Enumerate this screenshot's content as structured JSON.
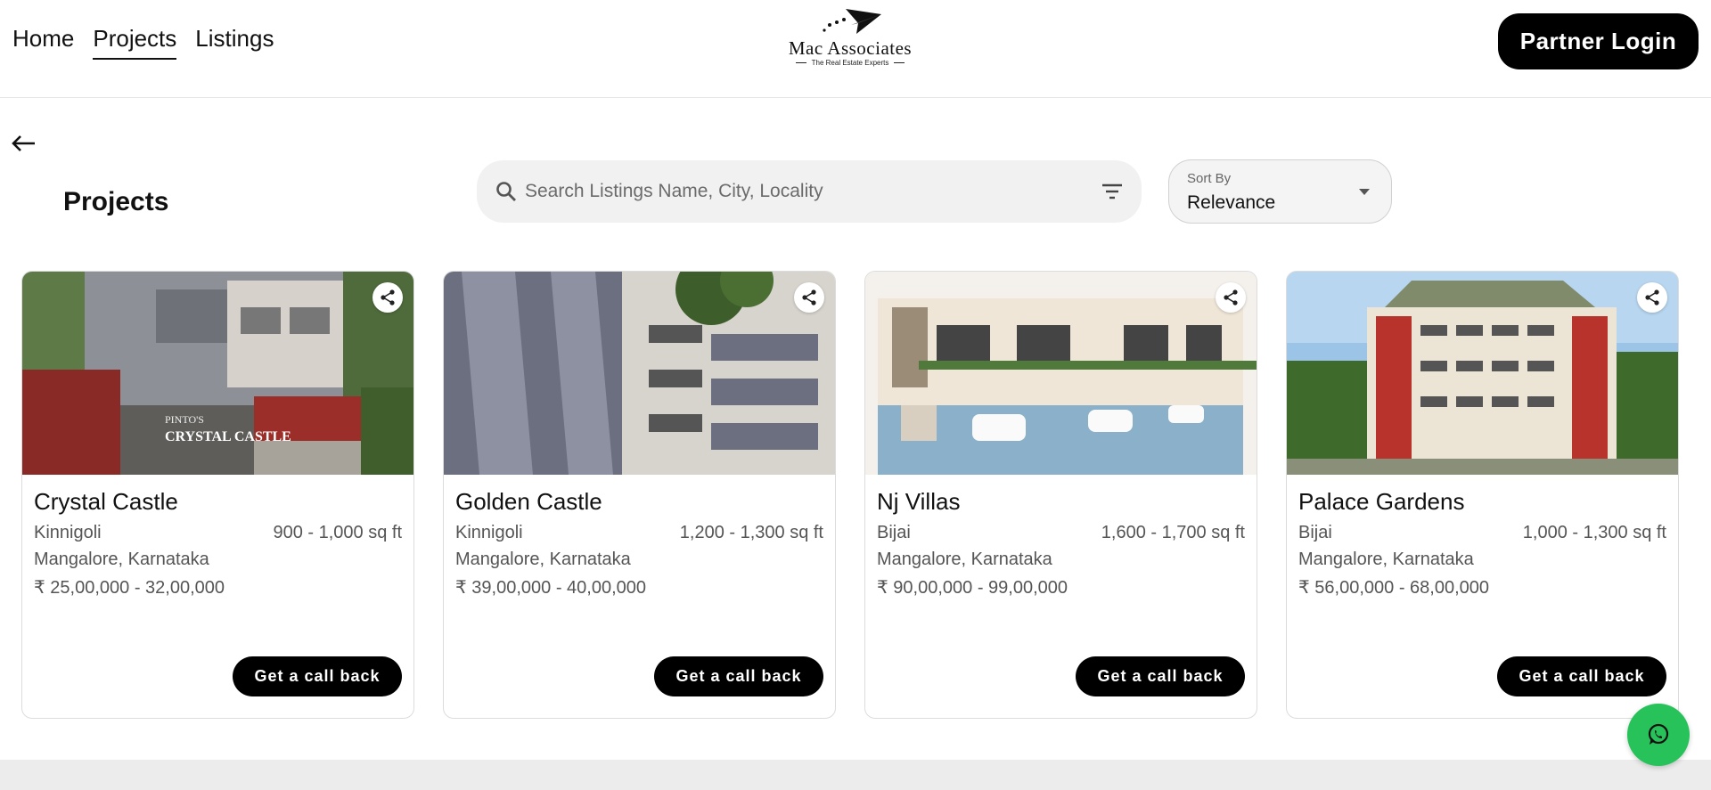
{
  "header": {
    "nav": [
      {
        "label": "Home",
        "active": false
      },
      {
        "label": "Projects",
        "active": true
      },
      {
        "label": "Listings",
        "active": false
      }
    ],
    "logo": {
      "name": "Mac Associates",
      "tagline": "The Real Estate Experts"
    },
    "partner_login_label": "Partner Login"
  },
  "page": {
    "back_icon": "arrow-left-icon",
    "title": "Projects"
  },
  "search": {
    "placeholder": "Search Listings Name, City, Locality",
    "value": "",
    "icon": "search-icon",
    "filter_icon": "filter-icon"
  },
  "sort": {
    "label": "Sort By",
    "selected": "Relevance"
  },
  "cards": [
    {
      "name": "Crystal Castle",
      "locality": "Kinnigoli",
      "area": "900 - 1,000 sq ft",
      "city": "Mangalore, Karnataka",
      "price": "₹ 25,00,000 - 32,00,000",
      "cta": "Get a call back",
      "sign_line1": "PINTO'S",
      "sign_line2": "CRYSTAL CASTLE"
    },
    {
      "name": "Golden Castle",
      "locality": "Kinnigoli",
      "area": "1,200 - 1,300 sq ft",
      "city": "Mangalore, Karnataka",
      "price": "₹ 39,00,000 - 40,00,000",
      "cta": "Get a call back"
    },
    {
      "name": "Nj Villas",
      "locality": "Bijai",
      "area": "1,600 - 1,700 sq ft",
      "city": "Mangalore, Karnataka",
      "price": "₹ 90,00,000 - 99,00,000",
      "cta": "Get a call back"
    },
    {
      "name": "Palace Gardens",
      "locality": "Bijai",
      "area": "1,000 - 1,300 sq ft",
      "city": "Mangalore, Karnataka",
      "price": "₹ 56,00,000 - 68,00,000",
      "cta": "Get a call back"
    }
  ],
  "colors": {
    "primary": "#000000",
    "whatsapp": "#27c25a",
    "search_bg": "#f1f1f1",
    "footer_bg": "#ececec"
  },
  "floating": {
    "whatsapp_icon": "whatsapp-icon"
  }
}
